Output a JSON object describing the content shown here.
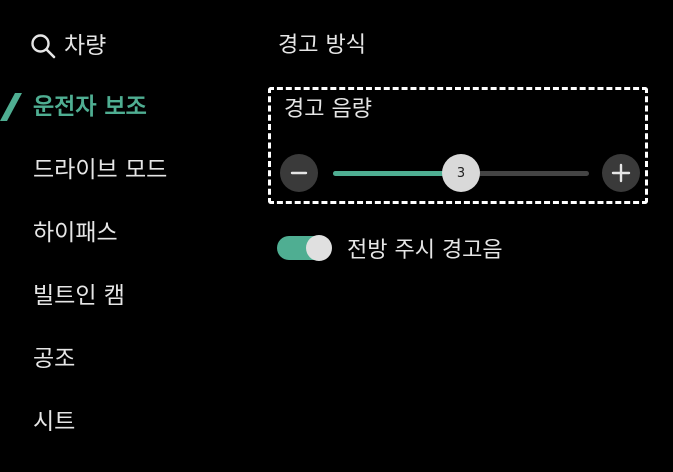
{
  "sidebar": {
    "search_label": "차량",
    "items": [
      {
        "label": "운전자 보조",
        "active": true
      },
      {
        "label": "드라이브 모드"
      },
      {
        "label": "하이패스"
      },
      {
        "label": "빌트인 캠"
      },
      {
        "label": "공조"
      },
      {
        "label": "시트"
      }
    ]
  },
  "content": {
    "section_title": "경고 방식",
    "volume": {
      "title": "경고 음량",
      "value": "3",
      "level_fraction": 0.5
    },
    "forward_attention_warning": {
      "label": "전방 주시 경고음",
      "enabled": true
    }
  },
  "colors": {
    "accent": "#4fae92",
    "background": "#000000",
    "text": "#e6e6e6"
  },
  "icons": {
    "search": "search-icon",
    "active_marker": "active-marker-icon",
    "minus": "minus-icon",
    "plus": "plus-icon"
  }
}
